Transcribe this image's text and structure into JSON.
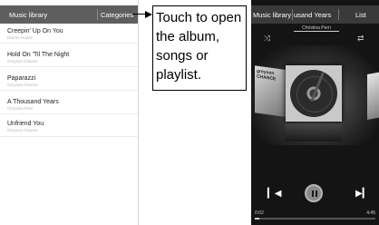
{
  "left_screen": {
    "header_title": "Music library",
    "categories_label": "Categories",
    "songs": [
      {
        "title": "Creepin' Up On You",
        "artist": "Darren Hayes"
      },
      {
        "title": "Hold On 'Til The Night",
        "artist": "Greyson Chance"
      },
      {
        "title": "Paparazzi",
        "artist": "Greyson Chance"
      },
      {
        "title": "A Thousand Years",
        "artist": "Christina Perri"
      },
      {
        "title": "Unfriend You",
        "artist": "Greyson Chance"
      }
    ]
  },
  "callout": {
    "lines": [
      "Touch to open",
      "the album,",
      "songs or",
      "playlist."
    ]
  },
  "right_screen": {
    "header_library": "Music library",
    "header_song": "usand Years",
    "header_list": "List",
    "artist": "Christina Perri",
    "album_left_text": "greyson CHANCE",
    "icons": {
      "shuffle": "shuffle-icon",
      "repeat": "repeat-icon",
      "prev": "previous-icon",
      "play": "pause-icon",
      "next": "next-icon"
    },
    "current_time": "0:02",
    "total_time": "4:45",
    "progress": 0.04
  }
}
